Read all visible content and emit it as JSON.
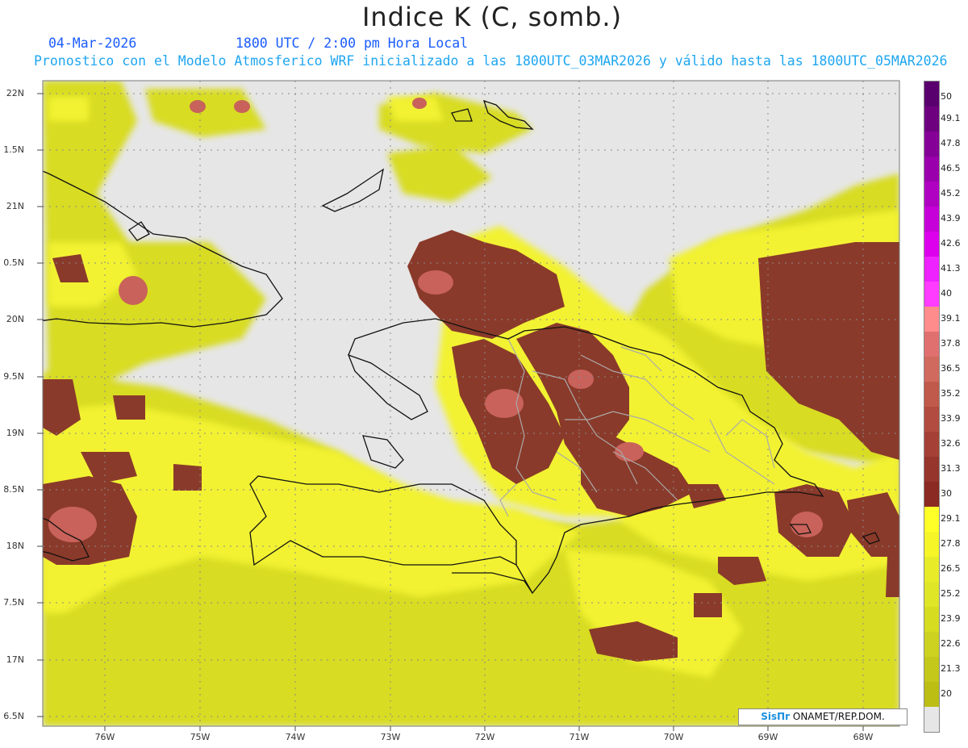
{
  "header": {
    "title": "Indice K (C, somb.)",
    "date": "04-Mar-2026",
    "time": "1800 UTC / 2:00 pm Hora Local",
    "description": "Pronostico con el Modelo Atmosferico WRF inicializado a las 1800UTC_03MAR2026 y válido hasta las  1800UTC_05MAR2026"
  },
  "axes": {
    "lat_labels": [
      "22N",
      "1.5N",
      "21N",
      "0.5N",
      "20N",
      "9.5N",
      "19N",
      "8.5N",
      "18N",
      "7.5N",
      "17N",
      "6.5N"
    ],
    "lon_labels": [
      "76W",
      "75W",
      "74W",
      "73W",
      "72W",
      "71W",
      "70W",
      "69W",
      "68W"
    ]
  },
  "colorbar": {
    "labels": [
      "50",
      "49.1",
      "47.8",
      "46.5",
      "45.2",
      "43.9",
      "42.6",
      "41.3",
      "40",
      "39.1",
      "37.8",
      "36.5",
      "35.2",
      "33.9",
      "32.6",
      "31.3",
      "30",
      "29.1",
      "27.8",
      "26.5",
      "25.2",
      "23.9",
      "22.6",
      "21.3",
      "20"
    ],
    "colors": [
      "#5a006e",
      "#6e0080",
      "#840096",
      "#9a00ac",
      "#b000c2",
      "#c600d8",
      "#dc00ec",
      "#ee22ff",
      "#ff3cff",
      "#ff8c8c",
      "#e07070",
      "#d06a5e",
      "#c05a4a",
      "#b24c40",
      "#a54036",
      "#96352c",
      "#8a2a22",
      "#ffff28",
      "#f5f528",
      "#e8ec28",
      "#dfe628",
      "#d6dc20",
      "#cdd220",
      "#c4c81a",
      "#bcbe14",
      "#e6e6e6"
    ]
  },
  "credit": {
    "logo": "SisПr",
    "text": " ONAMET/REP.DOM."
  },
  "colors": {
    "background": "#e6e6e6",
    "low_yellow": "#d8dc22",
    "yellow": "#f0f030",
    "brown": "#8a3a2a",
    "pink": "#c8625a",
    "coast": "#111111",
    "provinces": "#aaaaaa"
  }
}
